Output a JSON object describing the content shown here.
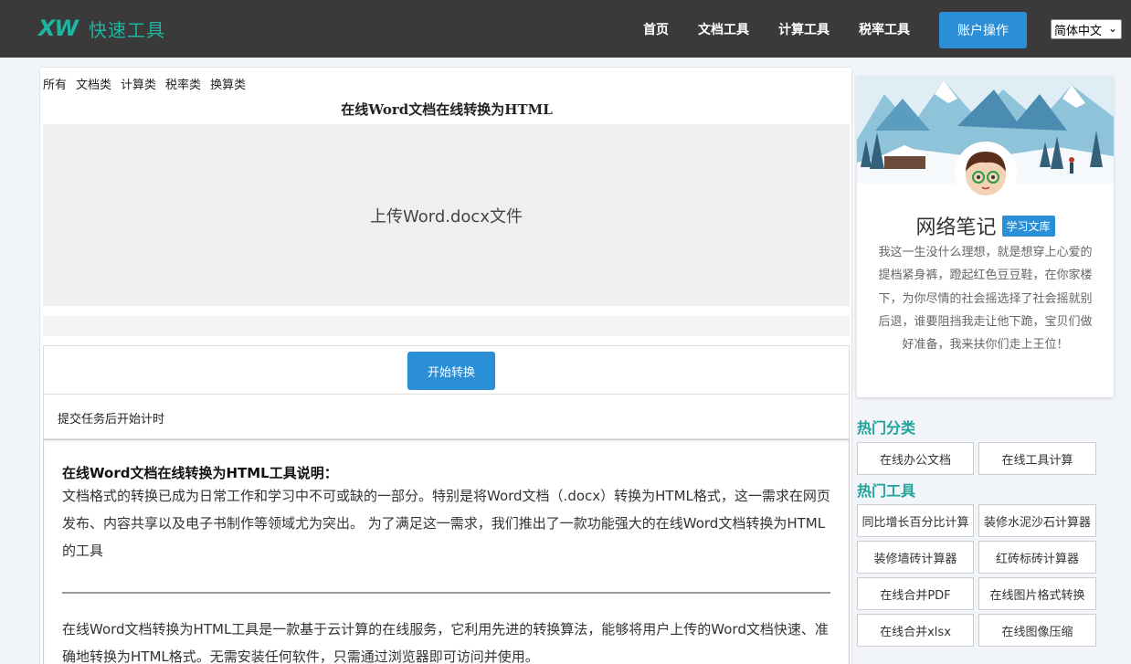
{
  "nav": {
    "logo_mark": "XW",
    "logo_text": "快速工具",
    "links": [
      "首页",
      "文档工具",
      "计算工具",
      "税率工具"
    ],
    "account_button": "账户操作",
    "language": "简体中文"
  },
  "main": {
    "categories": [
      "所有",
      "文档类",
      "计算类",
      "税率类",
      "换算类"
    ],
    "title": "在线Word文档在线转换为HTML",
    "upload_label": "上传Word.docx文件",
    "start_button": "开始转换",
    "timer_text": "提交任务后开始计时",
    "desc_title": "在线Word文档在线转换为HTML工具说明：",
    "desc_p1": "文档格式的转换已成为日常工作和学习中不可或缺的一部分。特别是将Word文档（.docx）转换为HTML格式，这一需求在网页发布、内容共享以及电子书制作等领域尤为突出。 为了满足这一需求，我们推出了一款功能强大的在线Word文档转换为HTML的工具",
    "desc_p2": "在线Word文档转换为HTML工具是一款基于云计算的在线服务，它利用先进的转换算法，能够将用户上传的Word文档快速、准确地转换为HTML格式。无需安装任何软件，只需通过浏览器即可访问并使用。"
  },
  "sidebar": {
    "profile_name": "网络笔记",
    "profile_badge": "学习文库",
    "bio": "我这一生没什么理想，就是想穿上心爱的提档紧身裤，蹬起红色豆豆鞋，在你家楼下，为你尽情的社会摇选择了社会摇就别后退，谁要阻挡我走让他下跪，宝贝们做好准备，我来扶你们走上王位！",
    "hot_categories_title": "热门分类",
    "hot_categories": [
      "在线办公文档",
      "在线工具计算"
    ],
    "hot_tools_title": "热门工具",
    "hot_tools": [
      "同比增长百分比计算",
      "装修水泥沙石计算器",
      "装修墙砖计算器",
      "红砖标砖计算器",
      "在线合并PDF",
      "在线图片格式转换",
      "在线合并xlsx",
      "在线图像压缩"
    ]
  },
  "colors": {
    "nav_bg": "#3a3a3a",
    "accent": "#1fb5a3",
    "button_blue": "#2a8fd6",
    "section_heading": "#1fa39a"
  }
}
